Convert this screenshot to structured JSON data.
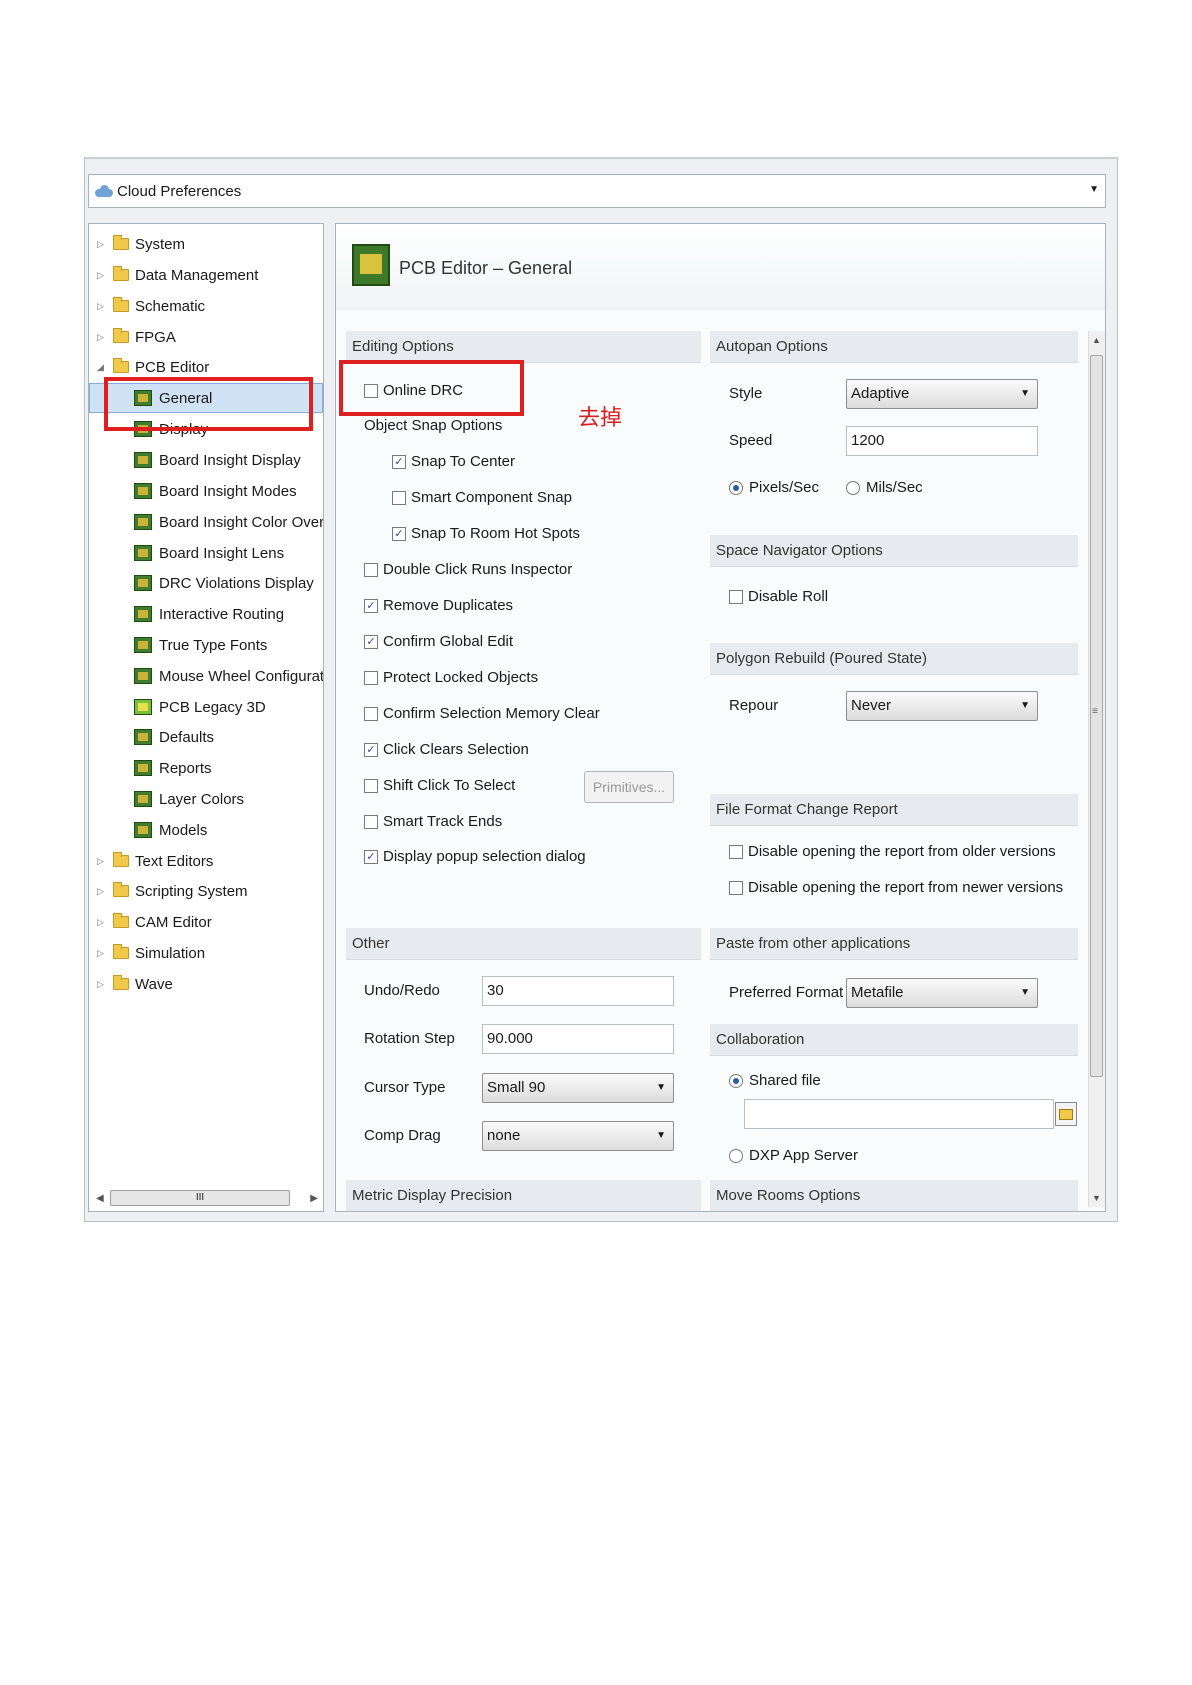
{
  "window": {
    "location_label": "Cloud Preferences",
    "location_icon": "cloud-icon"
  },
  "tree": {
    "items": [
      {
        "label": "System",
        "level": 0,
        "icon": "folder-icon"
      },
      {
        "label": "Data Management",
        "level": 0,
        "icon": "folder-icon"
      },
      {
        "label": "Schematic",
        "level": 0,
        "icon": "folder-icon"
      },
      {
        "label": "FPGA",
        "level": 0,
        "icon": "folder-icon"
      },
      {
        "label": "PCB Editor",
        "level": 0,
        "icon": "folder-icon"
      },
      {
        "label": "General",
        "level": 1,
        "icon": "pcb-icon",
        "selected": true
      },
      {
        "label": "Display",
        "level": 1,
        "icon": "pcb-icon"
      },
      {
        "label": "Board Insight Display",
        "level": 1,
        "icon": "pcb-icon"
      },
      {
        "label": "Board Insight Modes",
        "level": 1,
        "icon": "pcb-icon"
      },
      {
        "label": "Board Insight Color Overrid",
        "level": 1,
        "icon": "pcb-icon"
      },
      {
        "label": "Board Insight Lens",
        "level": 1,
        "icon": "pcb-icon"
      },
      {
        "label": "DRC Violations Display",
        "level": 1,
        "icon": "pcb-icon"
      },
      {
        "label": "Interactive Routing",
        "level": 1,
        "icon": "pcb-icon"
      },
      {
        "label": "True Type Fonts",
        "level": 1,
        "icon": "pcb-icon"
      },
      {
        "label": "Mouse Wheel Configuratior",
        "level": 1,
        "icon": "pcb-icon"
      },
      {
        "label": "PCB Legacy 3D",
        "level": 1,
        "icon": "pcb-3d-icon"
      },
      {
        "label": "Defaults",
        "level": 1,
        "icon": "pcb-icon"
      },
      {
        "label": "Reports",
        "level": 1,
        "icon": "pcb-icon"
      },
      {
        "label": "Layer Colors",
        "level": 1,
        "icon": "pcb-icon"
      },
      {
        "label": "Models",
        "level": 1,
        "icon": "pcb-icon"
      },
      {
        "label": "Text Editors",
        "level": 0,
        "icon": "folder-icon"
      },
      {
        "label": "Scripting System",
        "level": 0,
        "icon": "folder-icon"
      },
      {
        "label": "CAM Editor",
        "level": 0,
        "icon": "folder-icon"
      },
      {
        "label": "Simulation",
        "level": 0,
        "icon": "folder-icon"
      },
      {
        "label": "Wave",
        "level": 0,
        "icon": "folder-icon"
      }
    ],
    "scroll_grip": "III"
  },
  "page": {
    "title": "PCB Editor – General"
  },
  "editing": {
    "header": "Editing Options",
    "online_drc": {
      "label": "Online DRC",
      "checked": false
    },
    "object_snap_label": "Object Snap Options",
    "snap_to_center": {
      "label": "Snap To Center",
      "checked": true
    },
    "smart_component_snap": {
      "label": "Smart Component Snap",
      "checked": false
    },
    "snap_to_room": {
      "label": "Snap To Room Hot Spots",
      "checked": true
    },
    "double_click": {
      "label": "Double Click Runs Inspector",
      "checked": false
    },
    "remove_duplicates": {
      "label": "Remove Duplicates",
      "checked": true
    },
    "confirm_global": {
      "label": "Confirm Global Edit",
      "checked": true
    },
    "protect_locked": {
      "label": "Protect Locked Objects",
      "checked": false
    },
    "confirm_selection": {
      "label": "Confirm Selection Memory Clear",
      "checked": false
    },
    "click_clears": {
      "label": "Click Clears Selection",
      "checked": true
    },
    "shift_click": {
      "label": "Shift Click To Select",
      "checked": false
    },
    "primitives_button": "Primitives...",
    "smart_track": {
      "label": "Smart Track Ends",
      "checked": false
    },
    "display_popup": {
      "label": "Display popup selection dialog",
      "checked": true
    }
  },
  "other": {
    "header": "Other",
    "undo_label": "Undo/Redo",
    "undo_value": "30",
    "rotation_label": "Rotation Step",
    "rotation_value": "90.000",
    "cursor_label": "Cursor Type",
    "cursor_value": "Small 90",
    "comp_drag_label": "Comp Drag",
    "comp_drag_value": "none"
  },
  "metric_header": "Metric Display Precision",
  "autopan": {
    "header": "Autopan Options",
    "style_label": "Style",
    "style_value": "Adaptive",
    "speed_label": "Speed",
    "speed_value": "1200",
    "pixels_label": "Pixels/Sec",
    "mils_label": "Mils/Sec",
    "selected_unit": "Pixels/Sec"
  },
  "space_nav": {
    "header": "Space Navigator Options",
    "disable_roll": {
      "label": "Disable Roll",
      "checked": false
    }
  },
  "polygon": {
    "header": "Polygon Rebuild (Poured State)",
    "repour_label": "Repour",
    "repour_value": "Never"
  },
  "file_format": {
    "header": "File Format Change Report",
    "older": {
      "label": "Disable opening the report from older versions",
      "checked": false
    },
    "newer": {
      "label": "Disable opening the report from newer versions",
      "checked": false
    }
  },
  "paste": {
    "header": "Paste from other applications",
    "format_label": "Preferred Format",
    "format_value": "Metafile"
  },
  "collab": {
    "header": "Collaboration",
    "shared_label": "Shared file",
    "shared_path": "",
    "dxp_label": "DXP App Server",
    "selected": "Shared file"
  },
  "move_rooms_header": "Move Rooms Options",
  "annotation": {
    "note": "去掉",
    "color": "#e02020"
  }
}
